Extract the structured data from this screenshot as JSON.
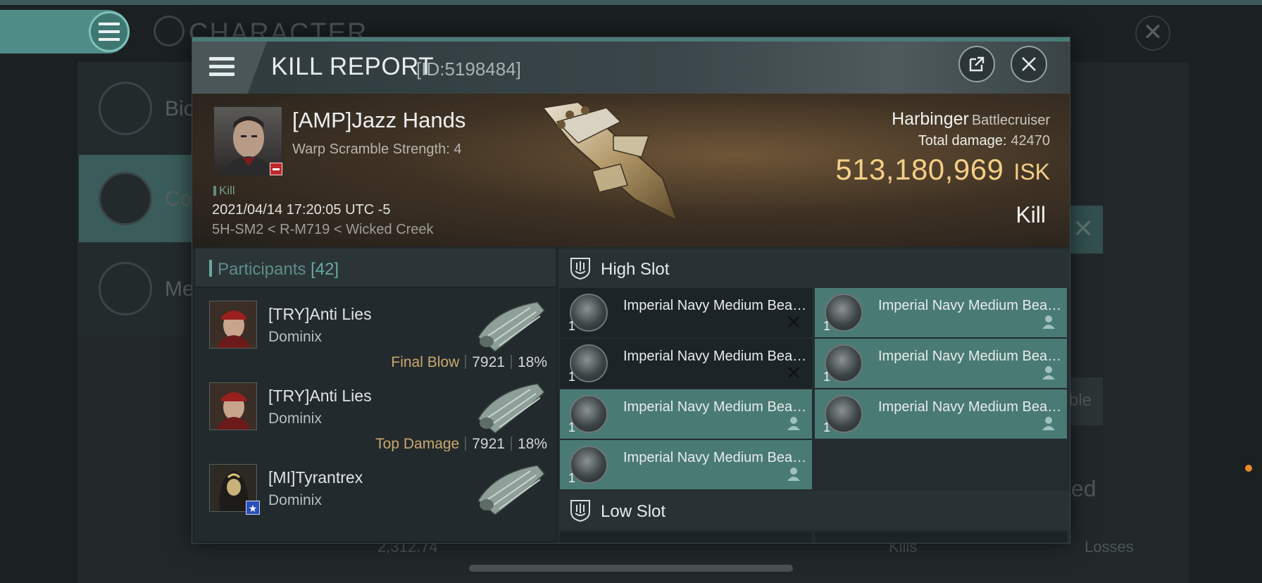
{
  "background": {
    "title": "CHARACTER",
    "nav_items": [
      {
        "label": "Bio"
      },
      {
        "label": "Co"
      },
      {
        "label": "Me"
      }
    ],
    "right_partial_button": "ble",
    "right_partial_heading": "ted",
    "bottom": {
      "value": "2,312.74",
      "kills_label": "Kills",
      "losses_label": "Losses"
    },
    "accent_color": "#4f8c87"
  },
  "kill_report": {
    "title": "KILL REPORT",
    "id_label": "[ID:5198484]",
    "victim": {
      "name": "[AMP]Jazz Hands",
      "warp_scramble": "Warp Scramble Strength: 4",
      "tag": "Kill",
      "datetime": "2021/04/14 17:20:05 UTC -5",
      "location": "5H-SM2 < R-M719 < Wicked Creek"
    },
    "ship": {
      "name": "Harbinger",
      "class": "Battlecruiser",
      "total_damage_label": "Total damage:",
      "total_damage": "42470",
      "isk_value": "513,180,969",
      "isk_unit": "ISK",
      "result": "Kill"
    },
    "participants": {
      "label": "Participants",
      "count": "[42]",
      "rows": [
        {
          "name": "[TRY]Anti Lies",
          "ship": "Dominix",
          "badge": "Final Blow",
          "damage": "7921",
          "percent": "18%"
        },
        {
          "name": "[TRY]Anti Lies",
          "ship": "Dominix",
          "badge": "Top Damage",
          "damage": "7921",
          "percent": "18%"
        },
        {
          "name": "[MI]Tyrantrex",
          "ship": "Dominix",
          "badge": "",
          "damage": "",
          "percent": ""
        }
      ]
    },
    "high_slot": {
      "label": "High Slot",
      "modules": [
        {
          "name": "Imperial Navy Medium Beam Laser",
          "qty": "1",
          "state": "destroyed"
        },
        {
          "name": "Imperial Navy Medium Beam Laser",
          "qty": "1",
          "state": "dropped"
        },
        {
          "name": "Imperial Navy Medium Beam Laser",
          "qty": "1",
          "state": "destroyed"
        },
        {
          "name": "Imperial Navy Medium Beam Laser",
          "qty": "1",
          "state": "dropped"
        },
        {
          "name": "Imperial Navy Medium Beam Laser",
          "qty": "1",
          "state": "dropped"
        },
        {
          "name": "Imperial Navy Medium Beam Laser",
          "qty": "1",
          "state": "dropped"
        },
        {
          "name": "Imperial Navy Medium Beam Laser",
          "qty": "1",
          "state": "dropped"
        }
      ]
    },
    "low_slot": {
      "label": "Low Slot"
    },
    "colors": {
      "isk": "#f3cf86",
      "final_blow": "#c9a86d",
      "dropped_module": "#4a7a74",
      "participants_accent": "#6aa8a0"
    }
  }
}
